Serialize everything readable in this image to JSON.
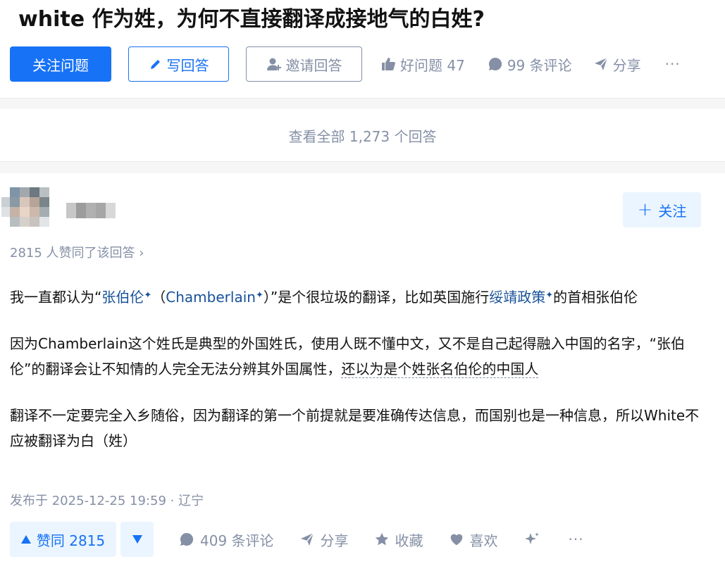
{
  "question": {
    "title": "white 作为姓，为何不直接翻译成接地气的白姓?",
    "follow_label": "关注问题",
    "write_label": "写回答",
    "invite_label": "邀请回答",
    "good_question_label": "好问题 47",
    "comments_label": "99 条评论",
    "share_label": "分享",
    "more_label": "···"
  },
  "view_all_label": "查看全部 1,273 个回答",
  "answer": {
    "follow_label": "关注",
    "voters_text": "2815 人赞同了该回答 ›",
    "paragraphs": {
      "p1_a": "我一直都认为“",
      "p1_link1": "张伯伦",
      "p1_b": "（",
      "p1_link2": "Chamberlain",
      "p1_c": "）”是个很垃圾的翻译，比如英国施行",
      "p1_link3": "绥靖政策",
      "p1_d": "的首相张伯伦",
      "p2_a": "因为Chamberlain这个姓氏是典型的外国姓氏，使用人既不懂中文，又不是自己起得融入中国的名字，“张伯伦”的翻译会让不知情的人完全无法分辨其外国属性，",
      "p2_dotted": "还以为是个姓张名伯伦的中国人",
      "p3": "翻译不一定要完全入乡随俗，因为翻译的第一个前提就是要准确传达信息，而国别也是一种信息，所以White不应被翻译为白（姓）"
    },
    "star_glyph": "✦",
    "published": "发布于 2025-12-25 19:59 · 辽宁",
    "vote_up_label": "赞同 2815",
    "comments_label": "409 条评论",
    "share_label": "分享",
    "favorite_label": "收藏",
    "like_label": "喜欢",
    "more_label": "···"
  },
  "colors": {
    "primary": "#1772f6",
    "primary_light": "#ebf5ff",
    "muted": "#8590a6",
    "link": "#175199"
  }
}
